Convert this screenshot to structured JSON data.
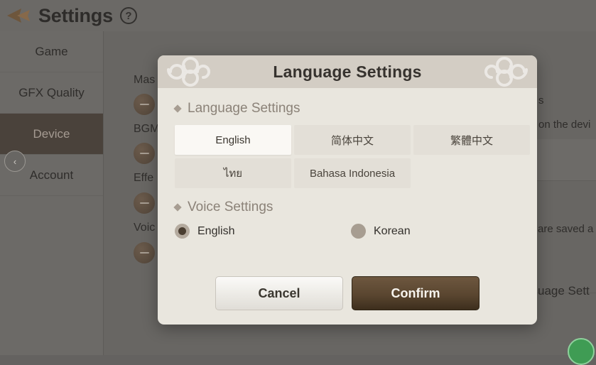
{
  "topbar": {
    "back_icon": "back-arrow-icon",
    "title": "Settings",
    "help_icon": "?"
  },
  "sidebar": {
    "collapse_icon": "‹",
    "items": [
      {
        "label": "Game",
        "active": false
      },
      {
        "label": "GFX Quality",
        "active": false
      },
      {
        "label": "Device",
        "active": true
      },
      {
        "label": "Account",
        "active": false
      }
    ]
  },
  "background": {
    "sliders": [
      {
        "label": "Mas",
        "control": "minus-button"
      },
      {
        "label": "BGM",
        "control": "minus-button"
      },
      {
        "label": "Effe",
        "control": "minus-button"
      },
      {
        "label": "Voic",
        "control": "minus-button"
      }
    ],
    "right_texts": [
      "s",
      "on the devi",
      "are saved a",
      "uage Sett"
    ]
  },
  "modal": {
    "title": "Language Settings",
    "language_section": {
      "heading": "Language Settings",
      "options": [
        {
          "label": "English",
          "selected": true
        },
        {
          "label": "简体中文",
          "selected": false
        },
        {
          "label": "繁體中文",
          "selected": false
        },
        {
          "label": "ไทย",
          "selected": false
        },
        {
          "label": "Bahasa Indonesia",
          "selected": false
        }
      ]
    },
    "voice_section": {
      "heading": "Voice Settings",
      "options": [
        {
          "label": "English",
          "selected": true
        },
        {
          "label": "Korean",
          "selected": false
        }
      ]
    },
    "footer": {
      "cancel_label": "Cancel",
      "confirm_label": "Confirm"
    }
  },
  "colors": {
    "backdrop": "#686663",
    "modal_bg": "#e9e6de",
    "modal_header_bg": "#d3cdc4",
    "accent_brown": "#5a4630",
    "selected_tab_bg": "#4a423b",
    "muted_text": "#8b8278"
  }
}
